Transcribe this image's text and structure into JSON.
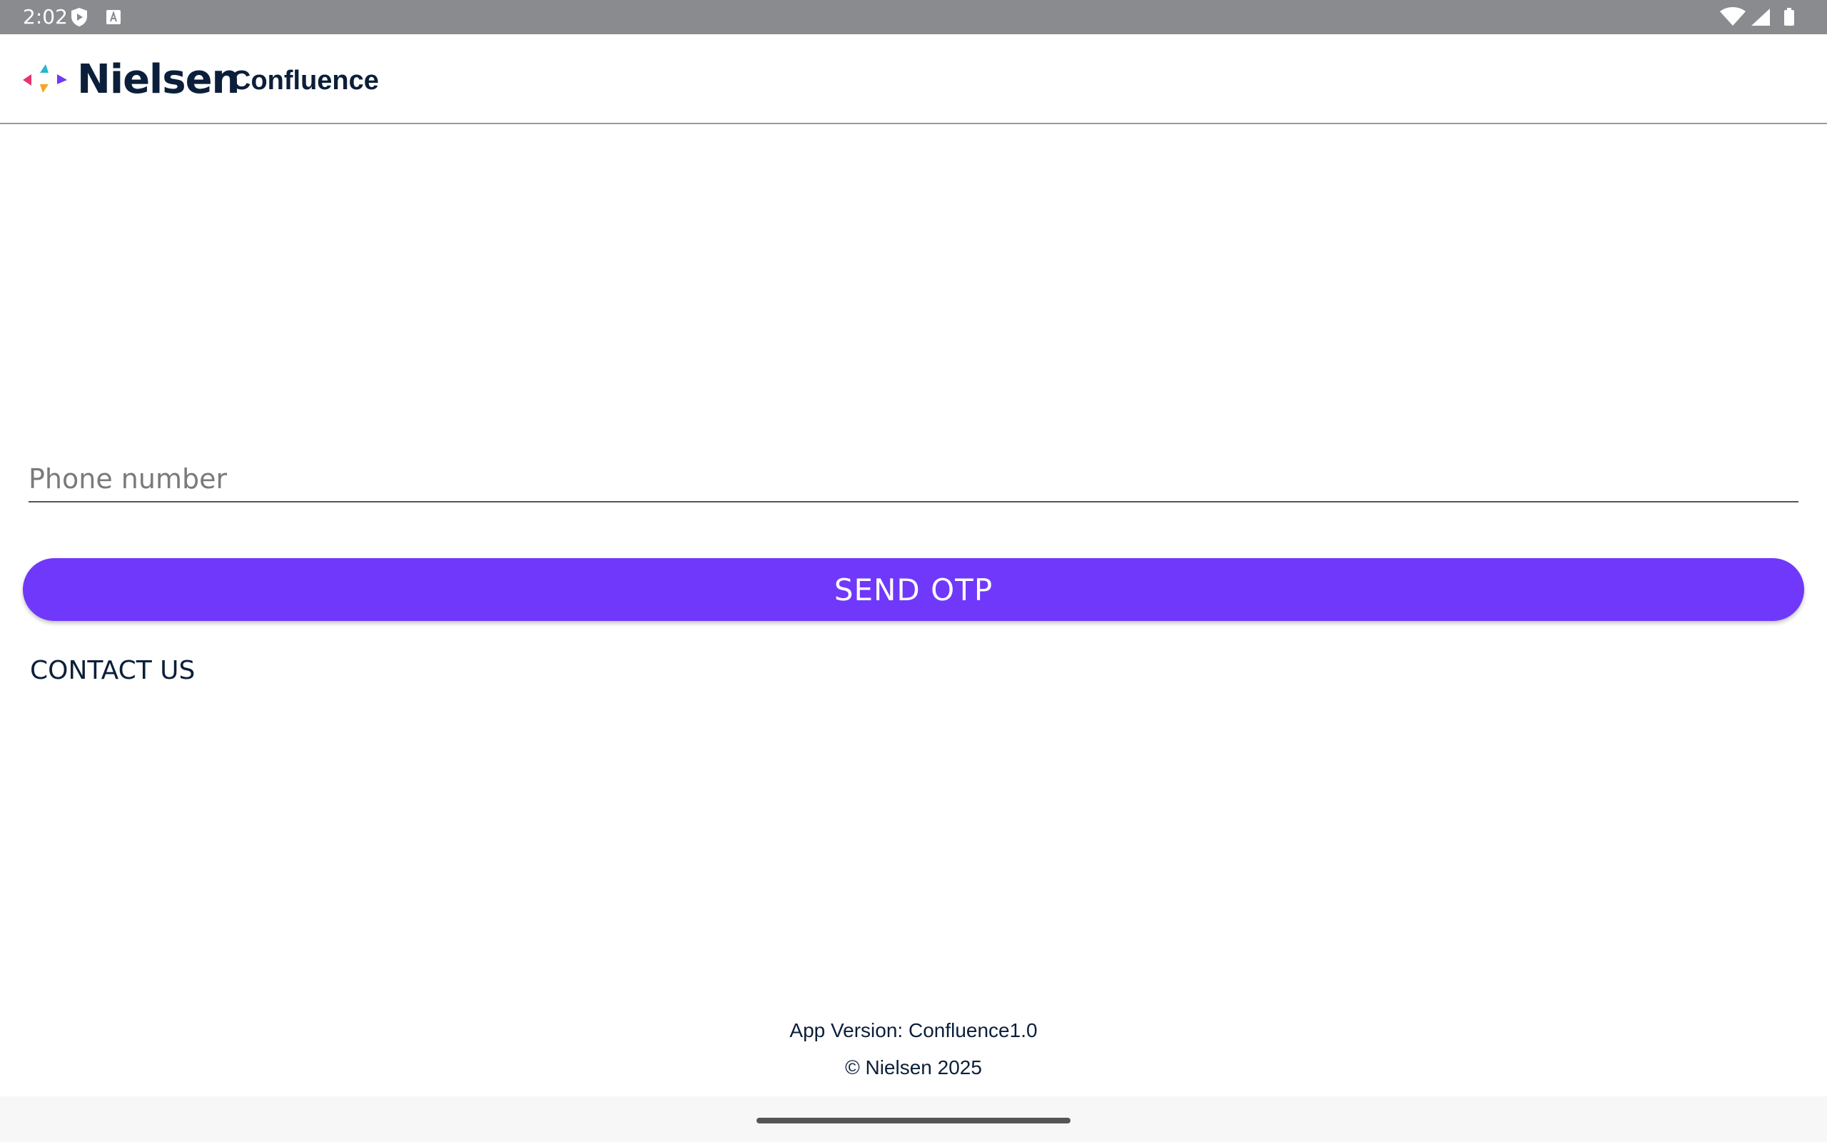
{
  "status_bar": {
    "time": "2:02",
    "icons_left": [
      "shield-play-icon",
      "keyboard-a-icon"
    ],
    "icons_right": [
      "wifi-icon",
      "cell-signal-icon",
      "battery-icon"
    ]
  },
  "app_bar": {
    "brand": "Nielsen",
    "title": "Confluence"
  },
  "form": {
    "phone_placeholder": "Phone number",
    "phone_value": "",
    "send_label": "SEND OTP",
    "contact_label": "CONTACT US"
  },
  "footer": {
    "version": "App Version: Confluence1.0",
    "copyright": "© Nielsen 2025"
  },
  "colors": {
    "accent": "#7038fa",
    "text_dark": "#0b1f3a",
    "status_bar": "#8a8b8e"
  }
}
